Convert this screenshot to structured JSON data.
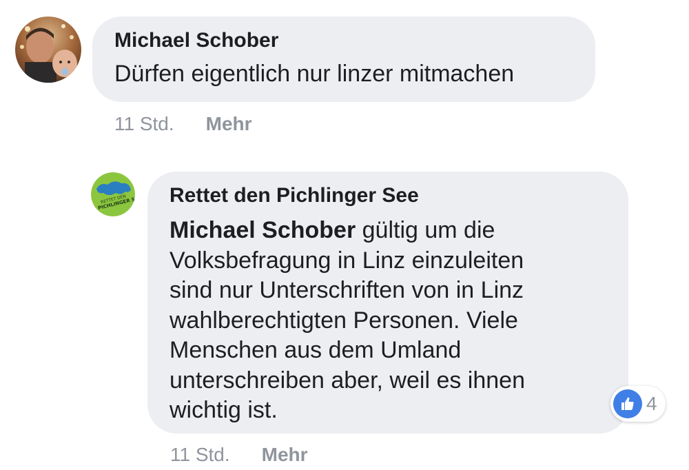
{
  "comments": [
    {
      "author": "Michael Schober",
      "text": "Dürfen eigentlich nur linzer mitmachen",
      "time": "11 Std.",
      "more_label": "Mehr",
      "avatar_icon": "user-photo-avatar"
    },
    {
      "author": "Rettet den Pichlinger See",
      "avatar_icon": "pichlinger-see-logo",
      "mention": "Michael Schober",
      "text_lines": [
        " gültig um die",
        "Volksbefragung in Linz einzuleiten",
        "sind nur Unterschriften von in Linz",
        "wahlberechtigten Personen. Viele",
        "Menschen aus dem Umland",
        "unterschreiben aber, weil es ihnen",
        "wichtig ist."
      ],
      "reaction_icon": "like-icon",
      "reaction_count": "4",
      "time": "11 Std.",
      "more_label": "Mehr"
    }
  ],
  "colors": {
    "bubble": "#eceef1",
    "meta_text": "#90949c",
    "like_blue": "#3f7fe6",
    "logo_green": "#8cc63f",
    "logo_blue": "#2a7fc1"
  }
}
